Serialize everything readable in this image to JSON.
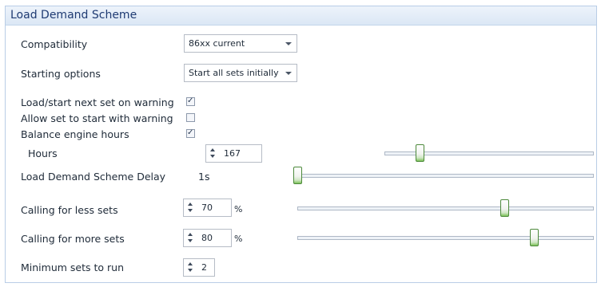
{
  "panel": {
    "title": "Load Demand Scheme"
  },
  "compatibility": {
    "label": "Compatibility",
    "value": "86xx current"
  },
  "starting_options": {
    "label": "Starting options",
    "value": "Start all sets initially"
  },
  "checkboxes": [
    {
      "label": "Load/start next set on warning",
      "checked": true
    },
    {
      "label": "Allow set to start with warning",
      "checked": false
    },
    {
      "label": "Balance engine hours",
      "checked": true
    }
  ],
  "check_mark": "✓",
  "hours": {
    "label": "Hours",
    "value": "167",
    "slider_fraction": 0.17
  },
  "delay": {
    "label": "Load Demand Scheme Delay",
    "value": "1s",
    "slider_fraction": 0.0
  },
  "less_sets": {
    "label": "Calling for less sets",
    "value": "70",
    "unit": "%",
    "slider_fraction": 0.7
  },
  "more_sets": {
    "label": "Calling for more sets",
    "value": "80",
    "unit": "%",
    "slider_fraction": 0.8
  },
  "min_sets": {
    "label": "Minimum sets to run",
    "value": "2"
  }
}
